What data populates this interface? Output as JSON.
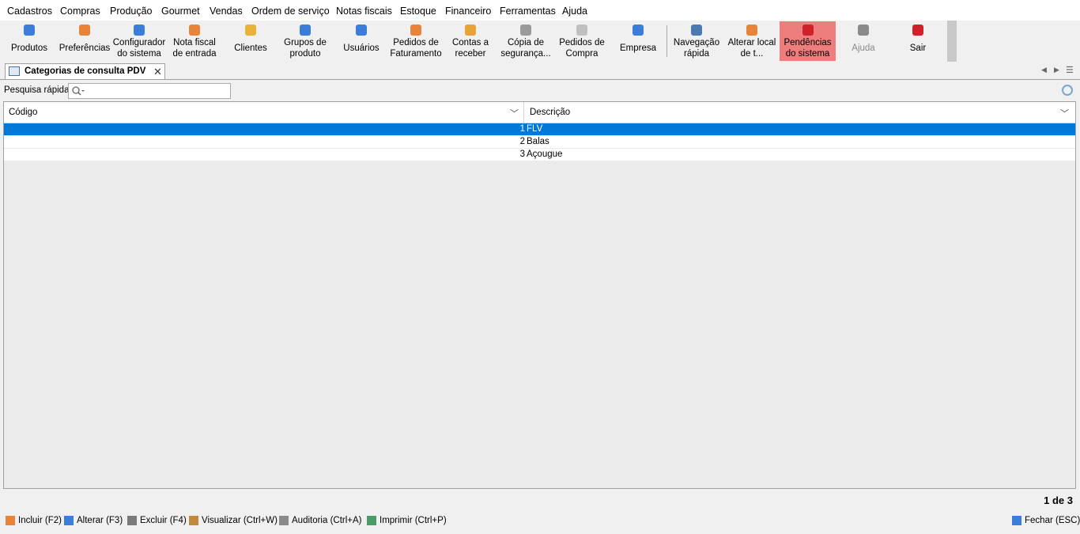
{
  "menu": [
    "Cadastros",
    "Compras",
    "Produção",
    "Gourmet",
    "Vendas",
    "Ordem de serviço",
    "Notas fiscais",
    "Estoque",
    "Financeiro",
    "Ferramentas",
    "Ajuda"
  ],
  "toolbar": [
    {
      "label": "Produtos",
      "icon": "products-icon",
      "color": "#3b7dd8"
    },
    {
      "label": "Preferências",
      "icon": "preferences-icon",
      "color": "#e8843a"
    },
    {
      "label": "Configurador\ndo sistema",
      "icon": "system-config-icon",
      "color": "#3b7dd8"
    },
    {
      "label": "Nota fiscal\nde entrada",
      "icon": "invoice-entry-icon",
      "color": "#e8843a"
    },
    {
      "label": "Clientes",
      "icon": "clients-icon",
      "color": "#e8b23a"
    },
    {
      "label": "Grupos de\nproduto",
      "icon": "product-groups-icon",
      "color": "#3b7dd8"
    },
    {
      "label": "Usuários",
      "icon": "users-icon",
      "color": "#3b7dd8"
    },
    {
      "label": "Pedidos de\nFaturamento",
      "icon": "billing-orders-icon",
      "color": "#e8843a"
    },
    {
      "label": "Contas a\nreceber",
      "icon": "receivables-icon",
      "color": "#e8a23a"
    },
    {
      "label": "Cópia de\nsegurança...",
      "icon": "backup-icon",
      "color": "#9a9a9a"
    },
    {
      "label": "Pedidos de\nCompra",
      "icon": "purchase-orders-icon",
      "color": "#c0c0c0"
    },
    {
      "label": "Empresa",
      "icon": "company-icon",
      "color": "#3b7dd8"
    },
    {
      "label": "Navegação\nrápida",
      "icon": "quick-navigation-icon",
      "color": "#4a7ab0"
    },
    {
      "label": "Alterar local\nde t...",
      "icon": "change-location-icon",
      "color": "#e8843a"
    },
    {
      "label": "Pendências\ndo sistema",
      "icon": "system-alerts-icon",
      "color": "#d0202a"
    },
    {
      "label": "Ajuda",
      "icon": "help-icon",
      "color": "#8a8a8a"
    },
    {
      "label": "Sair",
      "icon": "power-icon",
      "color": "#d0202a"
    }
  ],
  "tab": {
    "title": "Categorias de consulta PDV",
    "close": "✕"
  },
  "search": {
    "label": "Pesquisa rápida:",
    "placeholder": ""
  },
  "grid": {
    "columns": [
      "Código",
      "Descrição"
    ],
    "rows": [
      {
        "code": "1",
        "desc": "FLV"
      },
      {
        "code": "2",
        "desc": "Balas"
      },
      {
        "code": "3",
        "desc": "Açougue"
      }
    ],
    "selected_row": 0
  },
  "pagination": "1 de 3",
  "actions": [
    {
      "label": "Incluir (F2)",
      "icon": "add-icon",
      "color": "#e8843a"
    },
    {
      "label": "Alterar (F3)",
      "icon": "edit-icon",
      "color": "#3b7dd8"
    },
    {
      "label": "Excluir (F4)",
      "icon": "delete-icon",
      "color": "#7a7a7a"
    },
    {
      "label": "Visualizar (Ctrl+W)",
      "icon": "view-icon",
      "color": "#c08a3a"
    },
    {
      "label": "Auditoria (Ctrl+A)",
      "icon": "audit-icon",
      "color": "#8a8a8a"
    },
    {
      "label": "Imprimir (Ctrl+P)",
      "icon": "print-icon",
      "color": "#4a9a6a"
    }
  ],
  "close_action": {
    "label": "Fechar (ESC)",
    "icon": "close-window-icon",
    "color": "#3b7dd8"
  }
}
